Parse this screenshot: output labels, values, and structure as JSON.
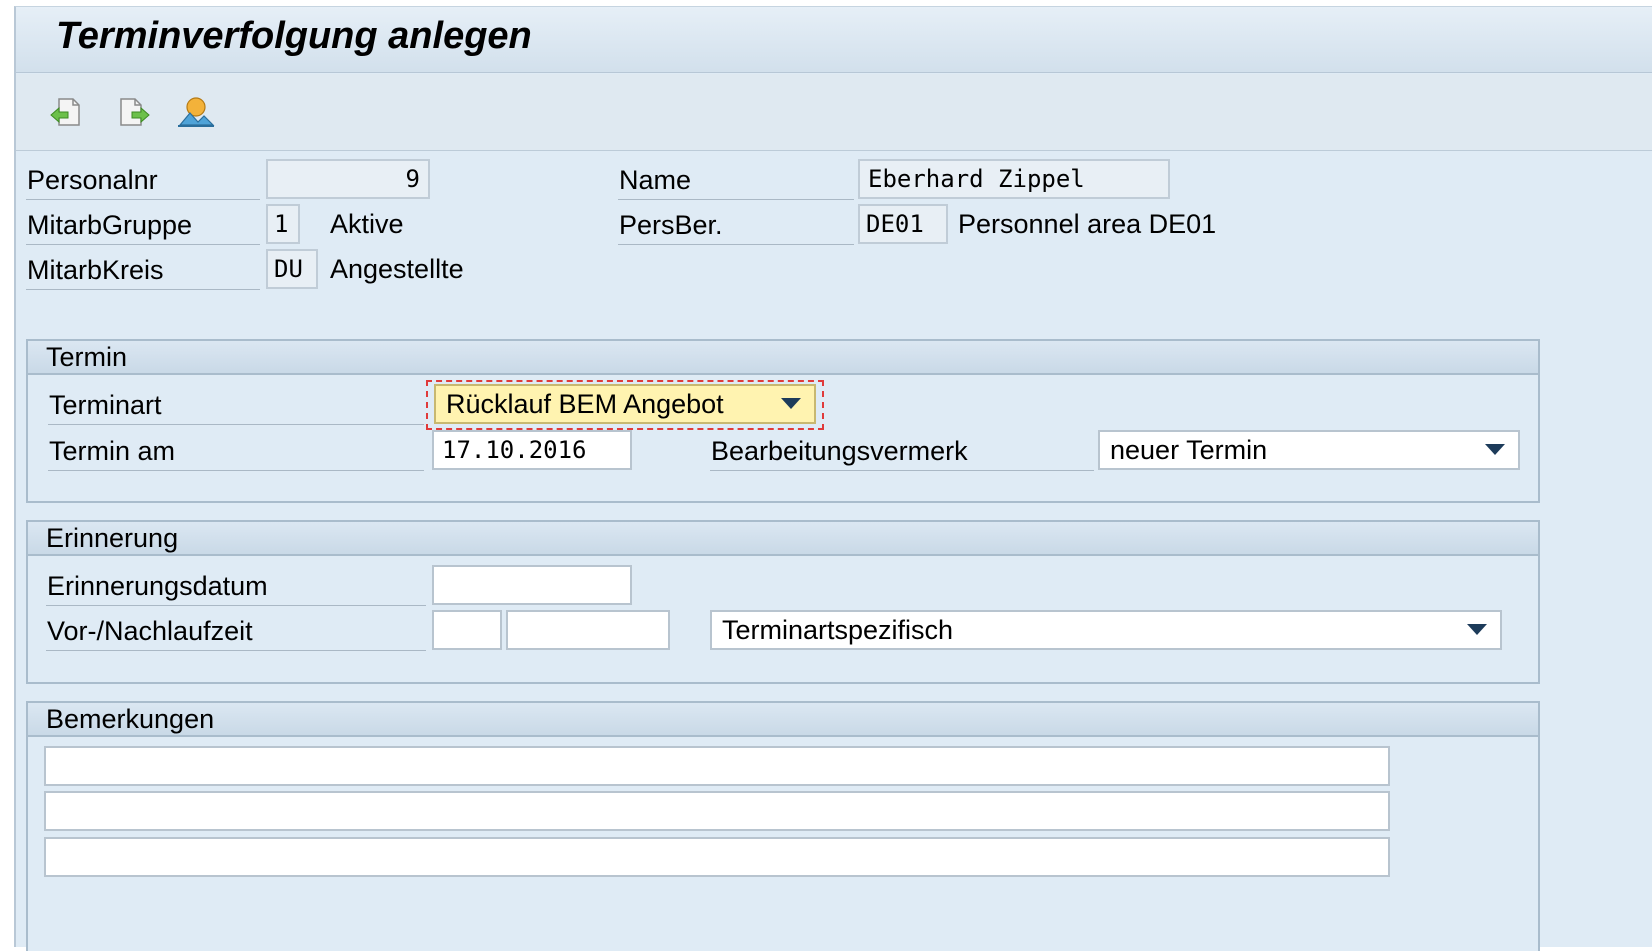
{
  "window": {
    "title": "Terminverfolgung anlegen"
  },
  "toolbar": {
    "buttons": [
      {
        "icon": "back-arrow-page-icon"
      },
      {
        "icon": "forward-arrow-page-icon"
      },
      {
        "icon": "overview-person-icon"
      }
    ]
  },
  "header": {
    "personalnr": {
      "label": "Personalnr",
      "value": "9"
    },
    "name": {
      "label": "Name",
      "value": "Eberhard Zippel"
    },
    "mitarbgruppe": {
      "label": "MitarbGruppe",
      "value": "1",
      "text": "Aktive"
    },
    "persber": {
      "label": "PersBer.",
      "value": "DE01",
      "text": "Personnel area DE01"
    },
    "mitarbkreis": {
      "label": "MitarbKreis",
      "value": "DU",
      "text": "Angestellte"
    }
  },
  "termin": {
    "title": "Termin",
    "terminart": {
      "label": "Terminart",
      "value": "Rücklauf BEM Angebot"
    },
    "termin_am": {
      "label": "Termin am",
      "value": "17.10.2016"
    },
    "bearbeitungsvermerk": {
      "label": "Bearbeitungsvermerk",
      "value": "neuer Termin"
    }
  },
  "erinnerung": {
    "title": "Erinnerung",
    "erinnerungsdatum": {
      "label": "Erinnerungsdatum",
      "value": ""
    },
    "vor_nachlaufzeit": {
      "label": "Vor-/Nachlaufzeit",
      "value1": "",
      "value2": "",
      "unit": "Terminartspezifisch"
    }
  },
  "bemerkungen": {
    "title": "Bemerkungen",
    "lines": [
      "",
      "",
      ""
    ]
  },
  "colors": {
    "accent_focus": "#e03a3a",
    "field_highlight": "#fff3b0",
    "background": "#dfebf5"
  }
}
